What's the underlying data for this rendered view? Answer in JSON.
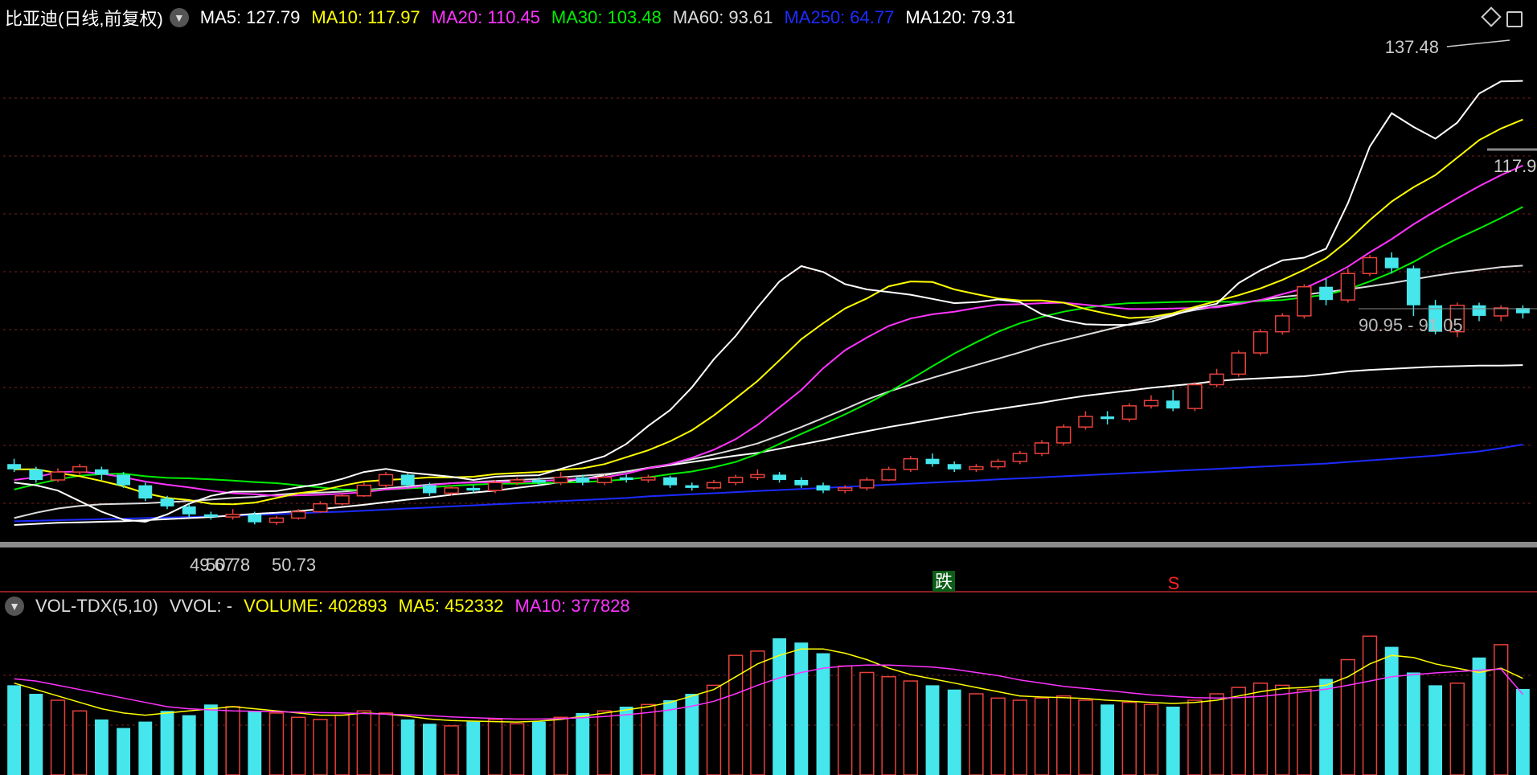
{
  "colors": {
    "up": "#e8413b",
    "down": "#45e6ec",
    "ma5": "#ffffff",
    "ma10": "#ffff00",
    "ma20": "#ff33ff",
    "ma30": "#00ee00",
    "ma60": "#dddddd",
    "ma120": "#ffffff",
    "ma250": "#1c2bff",
    "grid": "#7a1f1f"
  },
  "header": {
    "title": "比亚迪(日线,前复权)",
    "toggle_icon": "chevron-down-icon",
    "ma_labels": [
      {
        "key": "ma5",
        "label": "MA5:",
        "value": "127.79",
        "color": "#ffffff"
      },
      {
        "key": "ma10",
        "label": "MA10:",
        "value": "117.97",
        "color": "#ffff00"
      },
      {
        "key": "ma20",
        "label": "MA20:",
        "value": "110.45",
        "color": "#ff33ff"
      },
      {
        "key": "ma30",
        "label": "MA30:",
        "value": "103.48",
        "color": "#00ee00"
      },
      {
        "key": "ma60",
        "label": "MA60:",
        "value": "93.61",
        "color": "#dddddd"
      },
      {
        "key": "ma250",
        "label": "MA250:",
        "value": "64.77",
        "color": "#1c2bff"
      },
      {
        "key": "ma120",
        "label": "MA120:",
        "value": "79.31",
        "color": "#ffffff"
      }
    ],
    "right_icons": [
      "diamond-icon",
      "settings-icon"
    ]
  },
  "volume_header": {
    "title": "VOL-TDX(5,10)",
    "vvol": "VVOL: -",
    "labels": [
      {
        "label": "VOLUME:",
        "value": "402893",
        "color": "#ffff00"
      },
      {
        "label": "MA5:",
        "value": "452332",
        "color": "#ffff00"
      },
      {
        "label": "MA10:",
        "value": "377828",
        "color": "#ff33ff"
      }
    ]
  },
  "chart_data": {
    "type": "candlestick",
    "price_range": [
      46,
      142
    ],
    "volume_range": [
      0,
      700000
    ],
    "grid": true,
    "annotations": {
      "high": "137.48",
      "low": "49.67",
      "low_overlap": "50.78",
      "low_right": "50.73",
      "range_label": "90.95 - 91.05",
      "partial_label": "117.9",
      "signal_fall": "跌",
      "signal_s": "S"
    },
    "ma_values": {
      "ma5": [
        57.5,
        57.0,
        56.0,
        54.0,
        52.0,
        50.5,
        50.1,
        51.5,
        53.5,
        55.0,
        55.8,
        55.8,
        55.9,
        56.6,
        57.2,
        58.2,
        59.5,
        60.1,
        59.4,
        59.0,
        58.6,
        58.0,
        58.6,
        58.8,
        58.9,
        60.1,
        61.3,
        62.5,
        64.8,
        68.2,
        71.2,
        75.5,
        80.8,
        85.2,
        90.6,
        95.5,
        98.4,
        97.3,
        95.0,
        94.0,
        93.5,
        93.0,
        92.2,
        91.4,
        91.6,
        92.1,
        91.6,
        89.3,
        88.2,
        87.4,
        87.3,
        87.3,
        87.9,
        89.1,
        90.4,
        91.3,
        95.2,
        97.6,
        99.5,
        100.0,
        101.7,
        110.3,
        121.0,
        127.3,
        124.7,
        122.5,
        125.5,
        131.0,
        133.3,
        133.4
      ],
      "ma10": [
        60.0,
        60.0,
        59.3,
        58.7,
        57.8,
        56.8,
        55.5,
        54.6,
        54.2,
        53.5,
        53.4,
        53.7,
        54.6,
        55.5,
        56.0,
        56.9,
        57.7,
        58.0,
        58.2,
        58.5,
        58.5,
        58.6,
        59.1,
        59.3,
        59.5,
        59.9,
        60.2,
        61.0,
        62.3,
        63.6,
        65.3,
        67.4,
        70.2,
        73.4,
        76.7,
        80.6,
        84.6,
        87.6,
        90.4,
        92.3,
        94.6,
        95.5,
        95.4,
        94.0,
        93.1,
        92.3,
        91.9,
        91.9,
        91.5,
        90.3,
        89.4,
        88.6,
        88.8,
        89.5,
        90.7,
        91.8,
        92.9,
        94.2,
        95.8,
        97.7,
        99.9,
        103.2,
        107.1,
        110.6,
        113.3,
        115.6,
        118.9,
        122.2,
        124.4,
        126.1
      ],
      "ma20": [
        58.0,
        58.5,
        59.5,
        59.6,
        59.2,
        58.5,
        57.7,
        57.1,
        56.6,
        56.0,
        55.5,
        55.3,
        55.0,
        55.1,
        55.2,
        55.4,
        55.7,
        56.2,
        56.5,
        57.0,
        57.4,
        57.5,
        57.6,
        57.6,
        57.8,
        58.0,
        58.2,
        58.5,
        59.2,
        60.2,
        61.0,
        62.2,
        63.7,
        65.7,
        68.4,
        71.7,
        75.0,
        79.1,
        82.5,
        84.9,
        87.1,
        88.5,
        89.3,
        89.8,
        90.5,
        91.1,
        91.2,
        91.4,
        91.5,
        91.1,
        90.7,
        90.3,
        90.3,
        90.4,
        90.5,
        90.6,
        91.2,
        92.0,
        93.1,
        94.2,
        96.1,
        98.3,
        101.0,
        103.5,
        106.3,
        108.8,
        111.2,
        113.5,
        115.6,
        117.4
      ],
      "ma30": [
        56.2,
        57.2,
        58.1,
        58.8,
        59.1,
        59.2,
        58.7,
        58.4,
        58.3,
        58.1,
        57.9,
        57.6,
        57.4,
        57.0,
        56.6,
        56.2,
        56.1,
        56.2,
        56.4,
        56.6,
        56.9,
        57.1,
        57.3,
        57.3,
        57.4,
        57.5,
        57.6,
        57.8,
        58.1,
        58.5,
        59.1,
        59.6,
        60.4,
        61.4,
        62.9,
        64.8,
        66.7,
        68.5,
        70.4,
        72.4,
        74.6,
        77.0,
        79.5,
        81.9,
        84.0,
        86.0,
        87.6,
        88.8,
        89.8,
        90.5,
        91.1,
        91.4,
        91.5,
        91.6,
        91.7,
        91.7,
        91.6,
        91.8,
        92.0,
        92.5,
        93.0,
        94.0,
        95.5,
        97.2,
        99.2,
        101.5,
        103.6,
        105.5,
        107.5,
        109.6
      ],
      "ma60": [
        50.8,
        51.8,
        52.6,
        53.1,
        53.4,
        53.5,
        53.6,
        53.8,
        54.0,
        54.3,
        54.6,
        54.8,
        55.2,
        55.5,
        55.6,
        55.8,
        56.1,
        56.4,
        56.8,
        57.1,
        57.4,
        57.6,
        57.8,
        58.0,
        58.2,
        58.5,
        58.8,
        59.1,
        59.6,
        60.3,
        61.0,
        61.9,
        62.8,
        63.8,
        64.9,
        66.4,
        68.0,
        69.7,
        71.4,
        73.2,
        74.7,
        76.0,
        77.3,
        78.5,
        79.7,
        80.9,
        82.1,
        83.4,
        84.4,
        85.4,
        86.4,
        87.4,
        88.4,
        89.3,
        90.1,
        90.8,
        91.4,
        92.0,
        92.6,
        93.0,
        93.5,
        94.0,
        94.6,
        95.2,
        95.9,
        96.6,
        97.2,
        97.7,
        98.2,
        98.5
      ],
      "ma120": [
        49.5,
        49.7,
        49.9,
        50.0,
        50.1,
        50.2,
        50.4,
        50.6,
        50.8,
        51.0,
        51.3,
        51.6,
        51.8,
        52.1,
        52.5,
        52.9,
        53.3,
        53.8,
        54.3,
        54.7,
        55.2,
        55.6,
        56.0,
        56.5,
        57.0,
        57.6,
        58.2,
        58.9,
        59.6,
        60.2,
        60.8,
        61.4,
        62.0,
        62.6,
        63.1,
        63.9,
        64.7,
        65.5,
        66.4,
        67.2,
        68.0,
        68.7,
        69.4,
        70.1,
        70.8,
        71.4,
        72.0,
        72.6,
        73.3,
        73.9,
        74.4,
        74.9,
        75.4,
        75.8,
        76.2,
        76.7,
        77.0,
        77.2,
        77.4,
        77.6,
        78.0,
        78.5,
        78.8,
        79.0,
        79.2,
        79.4,
        79.5,
        79.6,
        79.6,
        79.7
      ],
      "ma250": [
        50.2,
        50.3,
        50.4,
        50.5,
        50.6,
        50.7,
        50.8,
        50.9,
        51.0,
        51.1,
        51.2,
        51.4,
        51.5,
        51.7,
        51.9,
        52.0,
        52.2,
        52.4,
        52.6,
        52.8,
        53.0,
        53.2,
        53.4,
        53.6,
        53.8,
        54.0,
        54.2,
        54.4,
        54.6,
        54.9,
        55.1,
        55.3,
        55.5,
        55.7,
        55.9,
        56.1,
        56.3,
        56.5,
        56.7,
        56.9,
        57.1,
        57.3,
        57.5,
        57.7,
        57.9,
        58.1,
        58.3,
        58.5,
        58.7,
        58.9,
        59.1,
        59.3,
        59.5,
        59.7,
        59.9,
        60.1,
        60.3,
        60.5,
        60.7,
        60.9,
        61.1,
        61.4,
        61.7,
        62.0,
        62.3,
        62.6,
        63.0,
        63.4,
        64.0,
        64.7
      ]
    },
    "volume": [
      420000,
      380000,
      350000,
      300000,
      260000,
      220000,
      250000,
      300000,
      280000,
      330000,
      320000,
      300000,
      290000,
      270000,
      260000,
      280000,
      300000,
      290000,
      260000,
      240000,
      230000,
      250000,
      260000,
      240000,
      250000,
      270000,
      290000,
      300000,
      320000,
      330000,
      350000,
      380000,
      420000,
      560000,
      580000,
      640000,
      620000,
      570000,
      510000,
      480000,
      460000,
      440000,
      420000,
      400000,
      380000,
      360000,
      350000,
      360000,
      370000,
      350000,
      330000,
      340000,
      330000,
      320000,
      350000,
      380000,
      410000,
      430000,
      420000,
      400000,
      450000,
      540000,
      650000,
      600000,
      480000,
      420000,
      430000,
      550000,
      610000,
      402893
    ],
    "volume_ma5": [
      430000,
      400000,
      370000,
      340000,
      310000,
      290000,
      280000,
      290000,
      300000,
      310000,
      320000,
      310000,
      300000,
      290000,
      280000,
      280000,
      290000,
      285000,
      275000,
      262000,
      255000,
      252000,
      250000,
      248000,
      252000,
      260000,
      275000,
      290000,
      305000,
      320000,
      340000,
      370000,
      400000,
      460000,
      520000,
      560000,
      590000,
      590000,
      570000,
      540000,
      500000,
      470000,
      450000,
      430000,
      410000,
      390000,
      370000,
      365000,
      362000,
      358000,
      350000,
      345000,
      340000,
      335000,
      340000,
      350000,
      370000,
      390000,
      405000,
      410000,
      420000,
      460000,
      520000,
      560000,
      550000,
      520000,
      500000,
      480000,
      500000,
      452332
    ],
    "volume_ma10": [
      450000,
      440000,
      420000,
      400000,
      380000,
      360000,
      340000,
      320000,
      310000,
      305000,
      300000,
      298000,
      296000,
      294000,
      292000,
      290000,
      288000,
      285000,
      282000,
      278000,
      272000,
      268000,
      265000,
      262000,
      262000,
      264000,
      268000,
      274000,
      282000,
      292000,
      305000,
      322000,
      345000,
      380000,
      420000,
      455000,
      480000,
      500000,
      510000,
      515000,
      515000,
      510000,
      505000,
      495000,
      480000,
      465000,
      445000,
      430000,
      415000,
      405000,
      395000,
      385000,
      375000,
      368000,
      362000,
      360000,
      362000,
      368000,
      378000,
      390000,
      402000,
      420000,
      440000,
      460000,
      470000,
      478000,
      484000,
      490000,
      496000,
      377828
    ],
    "candles": [
      [
        61.0,
        60.0,
        62.0,
        59.5
      ],
      [
        60.0,
        58.0,
        60.5,
        57.5
      ],
      [
        58.0,
        59.5,
        60.2,
        57.6
      ],
      [
        59.5,
        60.5,
        61.0,
        59.0
      ],
      [
        60.0,
        59.0,
        60.5,
        58.0
      ],
      [
        59.0,
        57.0,
        59.5,
        56.5
      ],
      [
        57.0,
        54.5,
        57.5,
        54.0
      ],
      [
        54.5,
        53.0,
        55.0,
        52.5
      ],
      [
        53.0,
        51.5,
        53.5,
        51.0
      ],
      [
        51.5,
        51.0,
        52.0,
        50.5
      ],
      [
        51.0,
        51.5,
        52.5,
        50.5
      ],
      [
        51.5,
        50.0,
        52.0,
        49.6
      ],
      [
        50.0,
        50.8,
        51.2,
        49.5
      ],
      [
        50.8,
        52.0,
        52.5,
        50.5
      ],
      [
        52.0,
        53.5,
        54.0,
        51.8
      ],
      [
        53.5,
        55.0,
        55.5,
        53.2
      ],
      [
        55.0,
        57.0,
        57.5,
        54.8
      ],
      [
        57.0,
        59.0,
        59.5,
        56.5
      ],
      [
        59.0,
        57.0,
        59.2,
        56.5
      ],
      [
        57.0,
        55.5,
        57.5,
        55.0
      ],
      [
        55.5,
        56.5,
        57.0,
        55.0
      ],
      [
        56.5,
        56.0,
        57.0,
        55.5
      ],
      [
        56.0,
        57.5,
        58.0,
        55.5
      ],
      [
        57.5,
        58.0,
        58.5,
        57.0
      ],
      [
        58.0,
        57.5,
        58.5,
        57.0
      ],
      [
        57.5,
        58.5,
        59.5,
        57.0
      ],
      [
        58.5,
        57.5,
        59.0,
        57.0
      ],
      [
        57.5,
        58.5,
        59.0,
        57.0
      ],
      [
        58.5,
        58.0,
        59.0,
        57.5
      ],
      [
        58.0,
        58.5,
        59.0,
        57.5
      ],
      [
        58.5,
        57.0,
        58.8,
        56.5
      ],
      [
        57.0,
        56.5,
        57.5,
        56.0
      ],
      [
        56.5,
        57.5,
        58.0,
        56.2
      ],
      [
        57.5,
        58.5,
        59.0,
        57.0
      ],
      [
        58.5,
        59.0,
        60.0,
        58.0
      ],
      [
        59.0,
        58.0,
        59.5,
        57.5
      ],
      [
        58.0,
        57.0,
        58.5,
        56.5
      ],
      [
        57.0,
        56.0,
        57.5,
        55.5
      ],
      [
        56.0,
        56.5,
        57.0,
        55.5
      ],
      [
        56.5,
        58.0,
        58.5,
        56.0
      ],
      [
        58.0,
        60.0,
        60.5,
        57.8
      ],
      [
        60.0,
        62.0,
        62.5,
        59.5
      ],
      [
        62.0,
        61.0,
        63.0,
        60.5
      ],
      [
        61.0,
        60.0,
        61.5,
        59.5
      ],
      [
        60.0,
        60.5,
        61.0,
        59.5
      ],
      [
        60.5,
        61.5,
        62.0,
        60.0
      ],
      [
        61.5,
        63.0,
        63.5,
        61.0
      ],
      [
        63.0,
        65.0,
        65.5,
        62.5
      ],
      [
        65.0,
        68.0,
        68.5,
        64.5
      ],
      [
        68.0,
        70.0,
        71.0,
        67.5
      ],
      [
        70.0,
        69.5,
        71.0,
        68.5
      ],
      [
        69.5,
        72.0,
        72.5,
        69.0
      ],
      [
        72.0,
        73.0,
        74.0,
        71.5
      ],
      [
        73.0,
        71.5,
        75.0,
        71.0
      ],
      [
        71.5,
        76.0,
        76.5,
        71.0
      ],
      [
        76.0,
        78.0,
        79.0,
        75.5
      ],
      [
        78.0,
        82.0,
        82.5,
        77.5
      ],
      [
        82.0,
        86.0,
        86.5,
        81.5
      ],
      [
        86.0,
        89.0,
        89.5,
        85.5
      ],
      [
        89.0,
        94.5,
        95.0,
        88.5
      ],
      [
        94.5,
        92.0,
        96.0,
        91.0
      ],
      [
        92.0,
        97.0,
        98.0,
        91.5
      ],
      [
        97.0,
        100.0,
        100.5,
        96.5
      ],
      [
        100.0,
        98.0,
        101.0,
        97.0
      ],
      [
        98.0,
        91.0,
        98.5,
        89.0
      ],
      [
        91.0,
        86.0,
        92.0,
        85.5
      ],
      [
        86.0,
        91.0,
        91.5,
        85.0
      ],
      [
        91.0,
        89.0,
        91.5,
        88.0
      ],
      [
        89.0,
        90.5,
        91.0,
        88.0
      ],
      [
        90.5,
        89.5,
        91.0,
        88.5
      ]
    ]
  }
}
